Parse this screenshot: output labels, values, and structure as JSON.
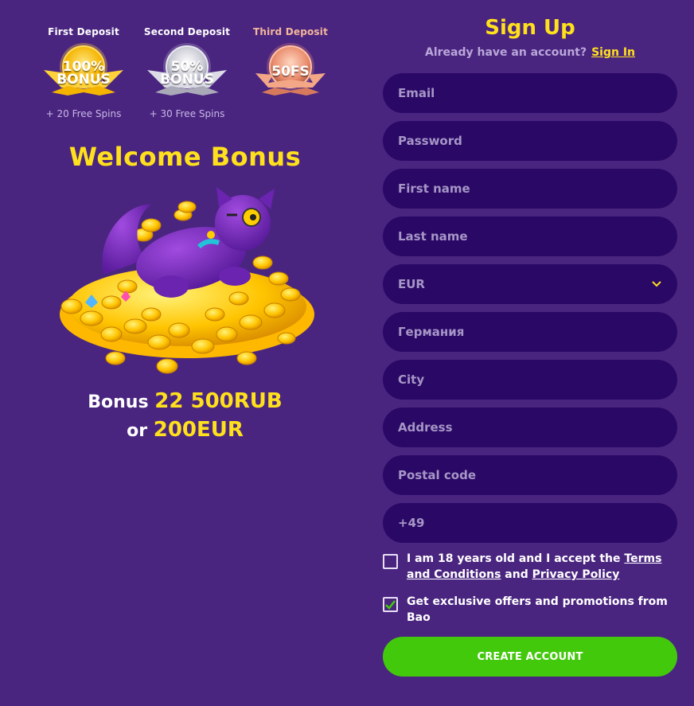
{
  "deposits": [
    {
      "title": "First Deposit",
      "coin_line1": "100%",
      "coin_line2": "BONUS",
      "sub": "+ 20 Free Spins",
      "color": "#f5b400"
    },
    {
      "title": "Second Deposit",
      "coin_line1": "50%",
      "coin_line2": "BONUS",
      "sub": "+ 30 Free Spins",
      "color": "#c7c7d2"
    },
    {
      "title": "Third Deposit",
      "coin_line1": "50FS",
      "coin_line2": "",
      "sub": "",
      "color": "#e98a6a"
    }
  ],
  "welcome": {
    "title": "Welcome Bonus"
  },
  "bonus": {
    "prefix": "Bonus",
    "amount_rub": "22 500RUB",
    "or": "or",
    "amount_eur": "200EUR"
  },
  "signup": {
    "title": "Sign Up",
    "have_account": "Already have an account?",
    "sign_in": "Sign In"
  },
  "form": {
    "email": "Email",
    "password": "Password",
    "first_name": "First name",
    "last_name": "Last name",
    "currency": "EUR",
    "country": "Германия",
    "city": "City",
    "address": "Address",
    "postal_code": "Postal code",
    "phone": "+49"
  },
  "consent": {
    "age_prefix": "I am 18 years old and I accept the",
    "terms": "Terms and Conditions",
    "and": "and",
    "privacy": "Privacy Policy",
    "age_checked": false,
    "offers": "Get exclusive offers and promotions from Bao",
    "offers_checked": true
  },
  "create_button": "CREATE ACCOUNT",
  "colors": {
    "background": "#4a2580",
    "field": "#2a0866",
    "accent": "#ffe01c",
    "button": "#43c90c"
  }
}
